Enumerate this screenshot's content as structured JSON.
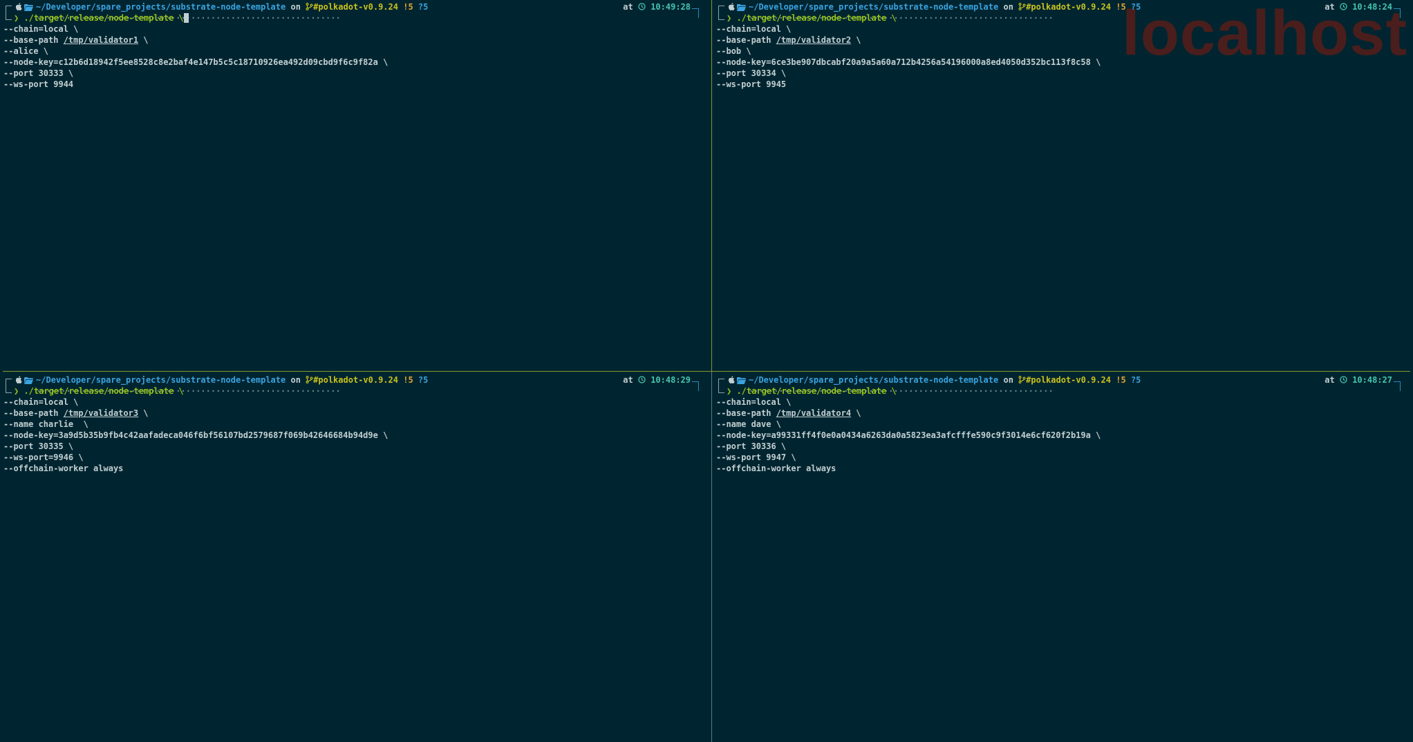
{
  "watermark": "localhost",
  "panes": [
    {
      "path": "~/Developer/spare_projects/substrate-node-template",
      "on_word": "on",
      "branch": "#polkadot-v0.9.24",
      "modified": "!5",
      "untracked": "?5",
      "at_word": "at",
      "time": "10:49:28",
      "command": "./target/release/node-template \\",
      "lines": [
        {
          "pre": "--chain=local \\",
          "ul": "",
          "post": ""
        },
        {
          "pre": "--base-path ",
          "ul": "/tmp/validator1",
          "post": " \\"
        },
        {
          "pre": "--alice \\",
          "ul": "",
          "post": ""
        },
        {
          "pre": "--node-key=c12b6d18942f5ee8528c8e2baf4e147b5c5c18710926ea492d09cbd9f6c9f82a \\",
          "ul": "",
          "post": ""
        },
        {
          "pre": "--port 30333 \\",
          "ul": "",
          "post": ""
        },
        {
          "pre": "--ws-port 9944",
          "ul": "",
          "post": ""
        }
      ]
    },
    {
      "path": "~/Developer/spare_projects/substrate-node-template",
      "on_word": "on",
      "branch": "#polkadot-v0.9.24",
      "modified": "!5",
      "untracked": "?5",
      "at_word": "at",
      "time": "10:48:24",
      "command": "./target/release/node-template \\",
      "lines": [
        {
          "pre": "--chain=local \\",
          "ul": "",
          "post": ""
        },
        {
          "pre": "--base-path ",
          "ul": "/tmp/validator2",
          "post": " \\"
        },
        {
          "pre": "--bob \\",
          "ul": "",
          "post": ""
        },
        {
          "pre": "--node-key=6ce3be907dbcabf20a9a5a60a712b4256a54196000a8ed4050d352bc113f8c58 \\",
          "ul": "",
          "post": ""
        },
        {
          "pre": "--port 30334 \\",
          "ul": "",
          "post": ""
        },
        {
          "pre": "--ws-port 9945",
          "ul": "",
          "post": ""
        }
      ]
    },
    {
      "path": "~/Developer/spare_projects/substrate-node-template",
      "on_word": "on",
      "branch": "#polkadot-v0.9.24",
      "modified": "!5",
      "untracked": "?5",
      "at_word": "at",
      "time": "10:48:29",
      "command": "./target/release/node-template \\",
      "lines": [
        {
          "pre": "--chain=local \\",
          "ul": "",
          "post": ""
        },
        {
          "pre": "--base-path ",
          "ul": "/tmp/validator3",
          "post": " \\"
        },
        {
          "pre": "--name charlie  \\",
          "ul": "",
          "post": ""
        },
        {
          "pre": "--node-key=3a9d5b35b9fb4c42aafadeca046f6bf56107bd2579687f069b42646684b94d9e \\",
          "ul": "",
          "post": ""
        },
        {
          "pre": "--port 30335 \\",
          "ul": "",
          "post": ""
        },
        {
          "pre": "--ws-port=9946 \\",
          "ul": "",
          "post": ""
        },
        {
          "pre": "--offchain-worker always",
          "ul": "",
          "post": ""
        }
      ]
    },
    {
      "path": "~/Developer/spare_projects/substrate-node-template",
      "on_word": "on",
      "branch": "#polkadot-v0.9.24",
      "modified": "!5",
      "untracked": "?5",
      "at_word": "at",
      "time": "10:48:27",
      "command": "./target/release/node-template \\",
      "lines": [
        {
          "pre": "--chain=local \\",
          "ul": "",
          "post": ""
        },
        {
          "pre": "--base-path ",
          "ul": "/tmp/validator4",
          "post": " \\"
        },
        {
          "pre": "--name dave \\",
          "ul": "",
          "post": ""
        },
        {
          "pre": "--node-key=a99331ff4f0e0a0434a6263da0a5823ea3afcfffe590c9f3014e6cf620f2b19a \\",
          "ul": "",
          "post": ""
        },
        {
          "pre": "--port 30336 \\",
          "ul": "",
          "post": ""
        },
        {
          "pre": "--ws-port 9947 \\",
          "ul": "",
          "post": ""
        },
        {
          "pre": "--offchain-worker always",
          "ul": "",
          "post": ""
        }
      ]
    }
  ],
  "icons": {
    "apple": "apple-icon",
    "folder": "folder-icon",
    "git": "git-branch-icon",
    "clock": "clock-icon"
  },
  "colors": {
    "background": "#012530",
    "path": "#3aa3e0",
    "branch": "#c9c21e",
    "modified": "#e2a632",
    "time": "#46c4b0",
    "prompt": "#97c41c",
    "watermark": "#4a1e1c"
  }
}
